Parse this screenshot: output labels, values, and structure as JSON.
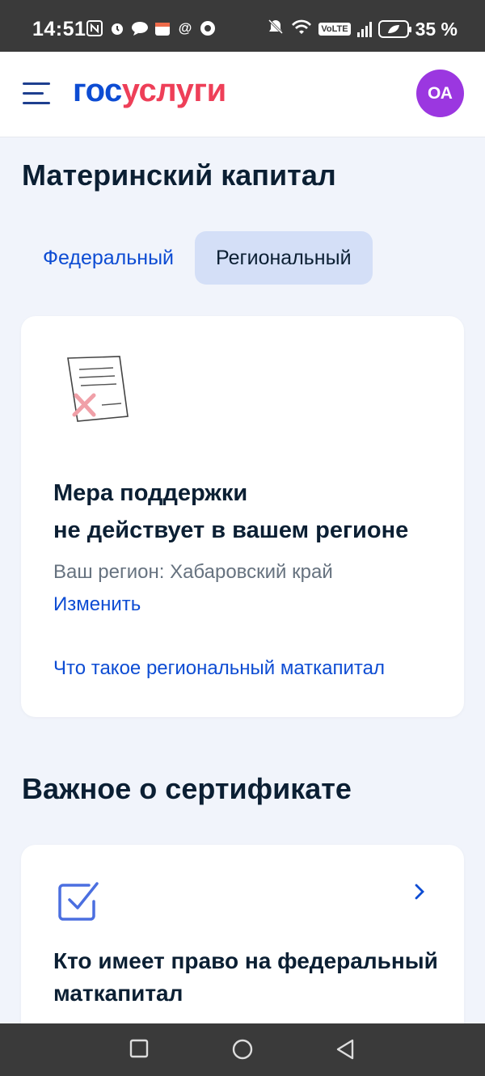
{
  "status_bar": {
    "time": "14:51",
    "battery": "35 %",
    "volte": "VoLTE"
  },
  "header": {
    "logo_part1": "гос",
    "logo_part2": "услуги",
    "avatar_initials": "ОА"
  },
  "page": {
    "title": "Материнский капитал",
    "tabs": [
      {
        "label": "Федеральный",
        "active": false
      },
      {
        "label": "Региональный",
        "active": true
      }
    ]
  },
  "region_card": {
    "title_line1": "Мера поддержки",
    "title_line2": "не действует в вашем регионе",
    "region_text": "Ваш регион: Хабаровский край",
    "change_link": "Изменить",
    "info_link": "Что такое региональный маткапитал"
  },
  "important": {
    "section_title": "Важное о сертификате",
    "card_title": "Кто имеет право на федеральный маткапитал",
    "icon": "checkbox-icon"
  },
  "colors": {
    "accent": "#0d4cd3",
    "logo_red": "#ee3f58",
    "avatar": "#9b37e0",
    "active_tab": "#d4dff7"
  }
}
